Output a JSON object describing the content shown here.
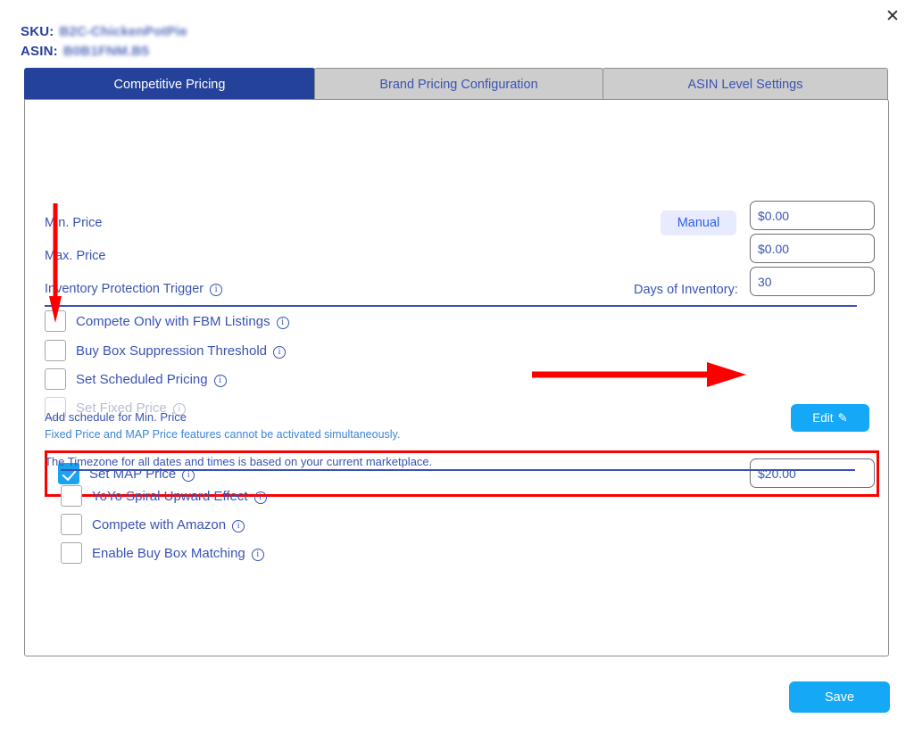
{
  "window": {
    "close_icon": "close-icon"
  },
  "header": {
    "sku_label": "SKU:",
    "sku_value": "B2C-ChickenPotPie",
    "asin_label": "ASIN:",
    "asin_value": "B0B1FNM.B5"
  },
  "tabs": [
    {
      "label": "Competitive Pricing",
      "active": true
    },
    {
      "label": "Brand Pricing Configuration",
      "active": false
    },
    {
      "label": "ASIN Level Settings",
      "active": false
    }
  ],
  "form": {
    "min_price_label": "Min. Price",
    "min_price_value": "$0.00",
    "manual_label": "Manual",
    "max_price_label": "Max. Price",
    "max_price_value": "$0.00",
    "inventory_trigger_label": "Inventory Protection Trigger",
    "days_of_inventory_label": "Days of Inventory:",
    "days_of_inventory_value": "30"
  },
  "checkboxes_top": [
    {
      "label": "Compete Only with FBM Listings",
      "checked": false,
      "disabled": false
    },
    {
      "label": "Buy Box Suppression Threshold",
      "checked": false,
      "disabled": false
    },
    {
      "label": "Set Scheduled Pricing",
      "checked": false,
      "disabled": false
    },
    {
      "label": "Set Fixed Price",
      "checked": false,
      "disabled": true
    }
  ],
  "warning_text": "Fixed Price and MAP Price features cannot be activated simultaneously.",
  "map_row": {
    "label": "Set MAP Price",
    "checked": true,
    "value": "$20.00"
  },
  "schedule": {
    "label": "Add schedule for Min. Price",
    "edit_label": "Edit",
    "edit_icon": "pencil-icon",
    "timezone_note": "The Timezone for all dates and times is based on your current marketplace."
  },
  "checkboxes_bottom": [
    {
      "label": "YoYo Spiral Upward Effect",
      "checked": false
    },
    {
      "label": "Compete with Amazon",
      "checked": false
    },
    {
      "label": "Enable Buy Box Matching",
      "checked": false
    }
  ],
  "footer": {
    "save_label": "Save"
  },
  "annotations": {
    "arrow_color": "#fc0000",
    "highlight_color": "#fc0000",
    "vertical_arrow": "down-arrow-annotation",
    "horizontal_arrow": "right-arrow-annotation"
  },
  "colors": {
    "active_tab": "#25429a",
    "inactive_tab": "#cdcdcd",
    "brand_blue": "#3a53b2",
    "accent_blue": "#14a8f7",
    "manual_bg": "#e7ebfd"
  }
}
